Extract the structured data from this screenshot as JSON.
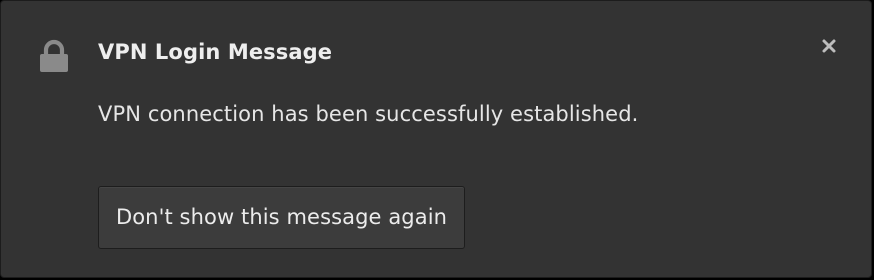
{
  "notification": {
    "app_icon": "lock-icon",
    "title": "VPN Login Message",
    "body": "VPN connection has been successfully established.",
    "close_icon": "close-icon",
    "action_label": "Don't show this message again"
  },
  "colors": {
    "background": "#333333",
    "button_background": "#3c3c3c",
    "text": "#ececec",
    "icon": "#8a8a8a"
  }
}
